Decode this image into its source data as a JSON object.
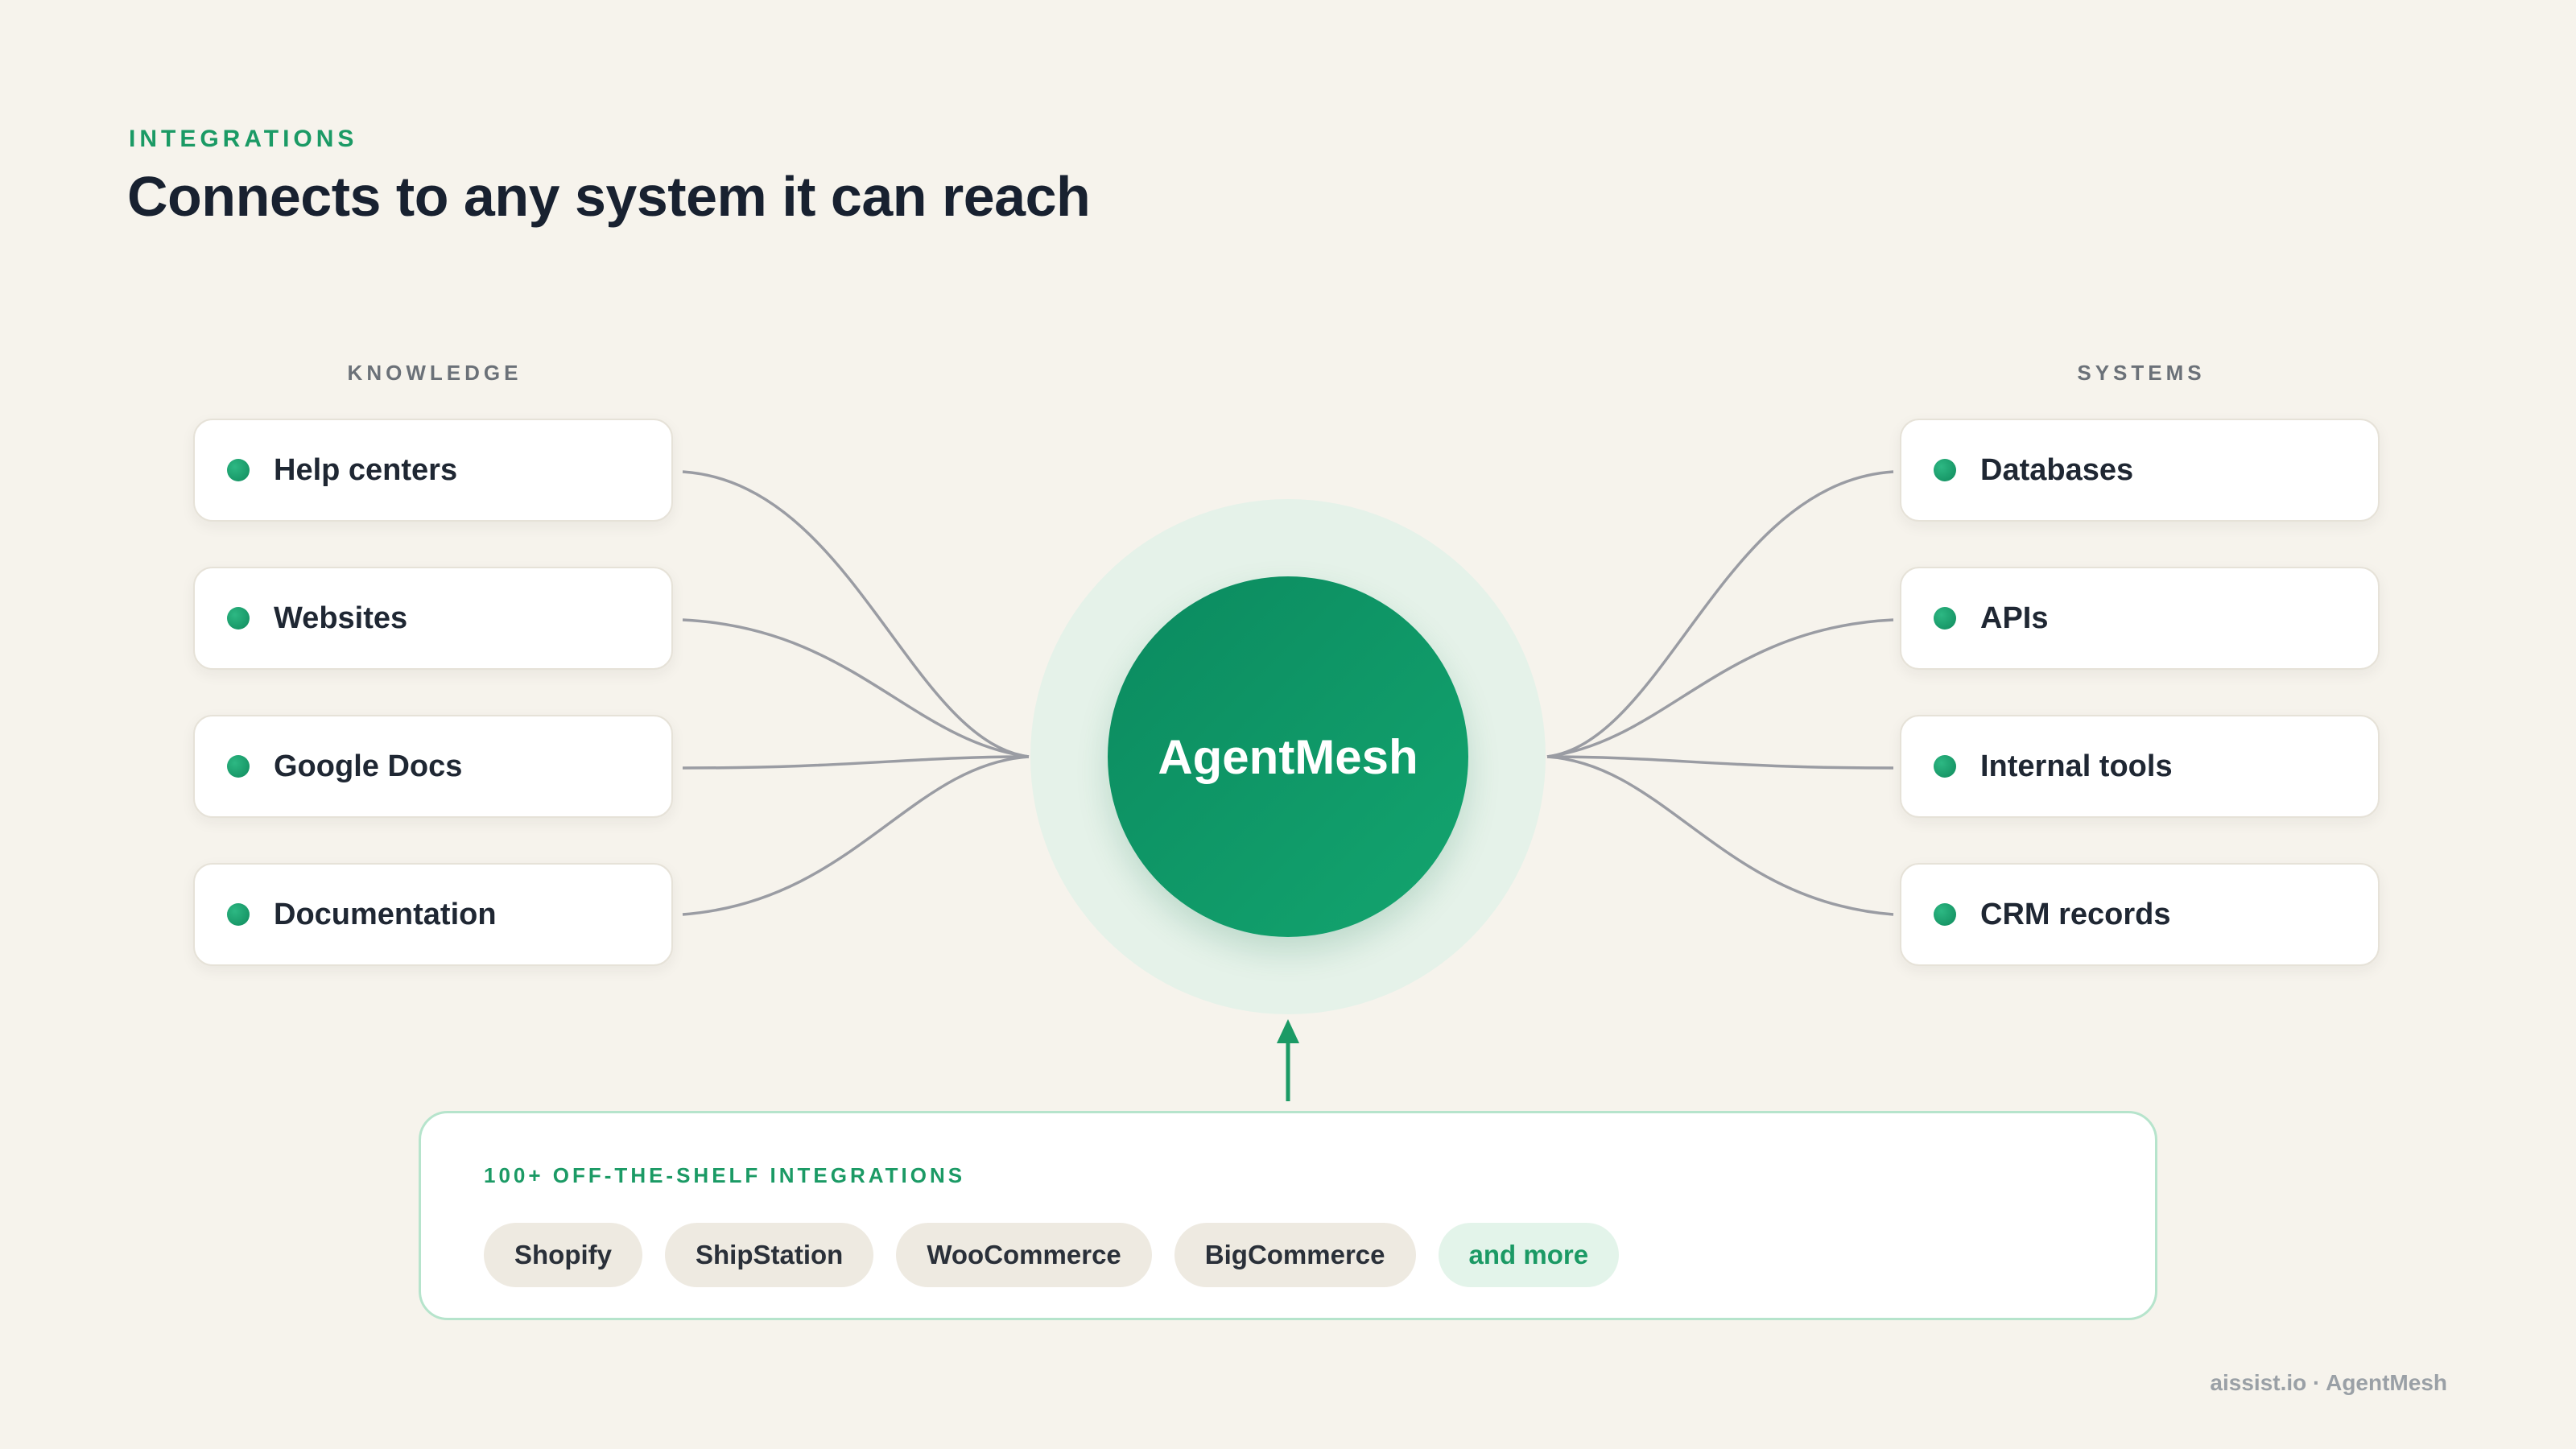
{
  "header": {
    "eyebrow": "INTEGRATIONS",
    "title": "Connects to any system it can reach"
  },
  "knowledge": {
    "label": "KNOWLEDGE",
    "items": [
      {
        "label": "Help centers"
      },
      {
        "label": "Websites"
      },
      {
        "label": "Google Docs"
      },
      {
        "label": "Documentation"
      }
    ]
  },
  "systems": {
    "label": "SYSTEMS",
    "items": [
      {
        "label": "Databases"
      },
      {
        "label": "APIs"
      },
      {
        "label": "Internal tools"
      },
      {
        "label": "CRM records"
      }
    ]
  },
  "hub": {
    "label": "AgentMesh"
  },
  "integrations": {
    "heading": "100+ OFF-THE-SHELF INTEGRATIONS",
    "chips": [
      {
        "label": "Shopify"
      },
      {
        "label": "ShipStation"
      },
      {
        "label": "WooCommerce"
      },
      {
        "label": "BigCommerce"
      },
      {
        "label": "and more"
      }
    ]
  },
  "footer": {
    "text": "aissist.io · AgentMesh"
  },
  "colors": {
    "accent": "#1b9a65",
    "hub_gradient_start": "#0b8a5f",
    "hub_gradient_end": "#13a56f",
    "halo": "#e5f2e9",
    "connector": "#9a9ca3",
    "background": "#f6f3ec"
  }
}
